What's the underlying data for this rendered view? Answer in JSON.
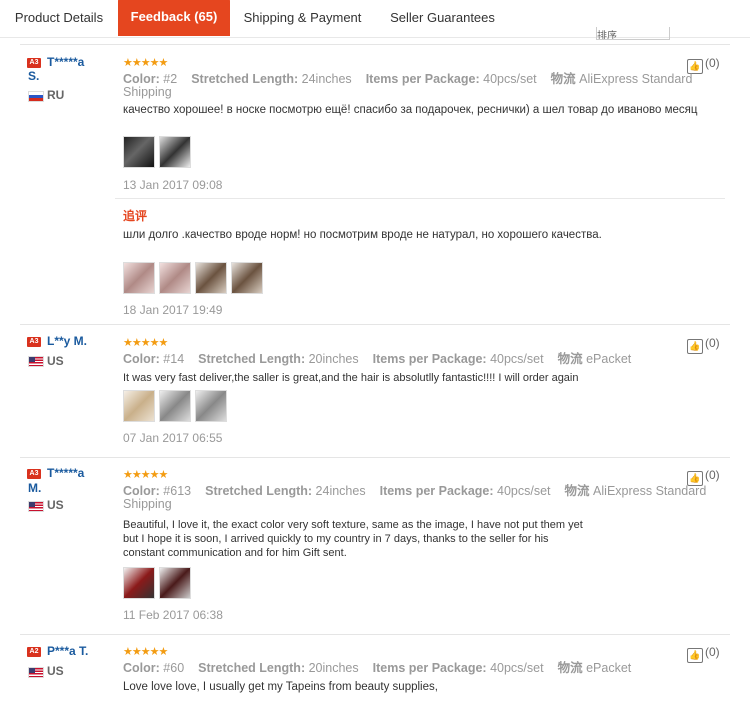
{
  "tabs": [
    {
      "label": "Product Details"
    },
    {
      "label": "Feedback (65)"
    },
    {
      "label": "Shipping & Payment"
    },
    {
      "label": "Seller Guarantees"
    }
  ],
  "sort_label": "排序",
  "labels": {
    "color": "Color:",
    "length": "Stretched Length:",
    "items": "Items per Package:",
    "logistics": "物流",
    "additional": "追评"
  },
  "reviews": [
    {
      "level": "A3",
      "user_line1": "T*****a",
      "user_line2": "S.",
      "country": "RU",
      "stars": "★★★★★",
      "color": "#2",
      "length": "24inches",
      "items": "40pcs/set",
      "shipping": "AliExpress Standard",
      "shipping2": "Shipping",
      "text": "качество хорошее! в носке посмотрю ещё! спасибо за подарочек, реснички) а шел товар до иваново месяц",
      "date": "13 Jan 2017 09:08",
      "likes": "(0)",
      "additional_text": "шли долго .качество вроде норм! но посмотрим вроде не натурал, но хорошего качества.",
      "additional_date": "18 Jan 2017 19:49"
    },
    {
      "level": "A3",
      "user_line1": "L**y M.",
      "country": "US",
      "stars": "★★★★★",
      "color": "#14",
      "length": "20inches",
      "items": "40pcs/set",
      "shipping": "ePacket",
      "text": "It was very fast deliver,the saller is great,and the hair is absolutlly fantastic!!!! I will order again",
      "date": "07 Jan 2017 06:55",
      "likes": "(0)"
    },
    {
      "level": "A3",
      "user_line1": "T*****a",
      "user_line2": "M.",
      "country": "US",
      "stars": "★★★★★",
      "color": "#613",
      "length": "24inches",
      "items": "40pcs/set",
      "shipping": "AliExpress Standard",
      "shipping2": "Shipping",
      "text": "Beautiful, I love it, the exact color very soft texture, same as the image, I have not put them yet but I hope it is soon, I arrived quickly to my country in  7 days,  thanks to the seller for his constant communication and for him Gift sent.",
      "date": "11 Feb 2017 06:38",
      "likes": "(0)"
    },
    {
      "level": "A2",
      "user_line1": "P***a T.",
      "country": "US",
      "stars": "★★★★★",
      "color": "#60",
      "length": "20inches",
      "items": "40pcs/set",
      "shipping": "ePacket",
      "text": "Love love love, I usually get my Tapeins from beauty supplies,",
      "likes": "(0)"
    }
  ]
}
